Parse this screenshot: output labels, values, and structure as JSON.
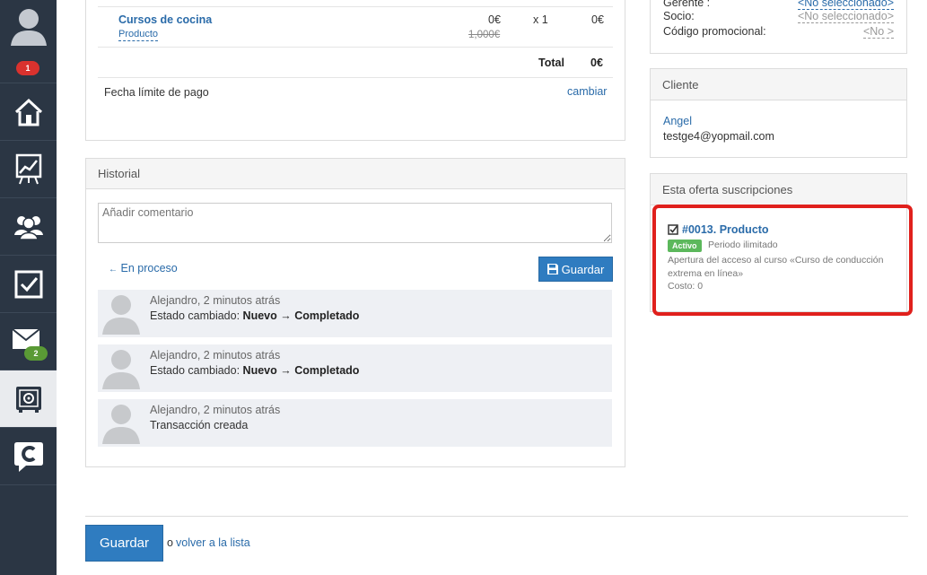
{
  "sidebar": {
    "notifications_badge": "1",
    "mail_badge": "2",
    "icons": [
      "user-avatar-icon",
      "home-icon",
      "chart-icon",
      "users-icon",
      "checkbox-icon",
      "mail-icon",
      "safe-icon",
      "chat-logo-icon"
    ]
  },
  "order": {
    "item_name": "Cursos de cocina",
    "item_type": "Producto",
    "price": "0€",
    "old_price": "1,000€",
    "qty": "x 1",
    "line_total": "0€",
    "total_label": "Total",
    "total_value": "0€",
    "due_label": "Fecha límite de pago",
    "due_action": "cambiar"
  },
  "history": {
    "title": "Historial",
    "comment_placeholder": "Añadir comentario",
    "status_link": "En proceso",
    "save_label": "Guardar",
    "items": [
      {
        "author": "Alejandro",
        "time": ", 2 minutos atrás",
        "prefix": "Estado cambiado: ",
        "from": "Nuevo",
        "arrow": " → ",
        "to": "Completado"
      },
      {
        "author": "Alejandro",
        "time": ", 2 minutos atrás",
        "prefix": "Estado cambiado: ",
        "from": "Nuevo",
        "arrow": " → ",
        "to": "Completado"
      },
      {
        "author": "Alejandro",
        "time": ", 2 minutos atrás",
        "prefix": "Transacción creada",
        "from": "",
        "arrow": "",
        "to": ""
      }
    ]
  },
  "details": {
    "manager_label": "Gerente :",
    "manager_value": "<No seleccionado>",
    "partner_label": "Socio:",
    "partner_value": "<No seleccionado>",
    "promo_label": "Código promocional:",
    "promo_value": "<No >"
  },
  "client": {
    "title": "Cliente",
    "name": "Angel",
    "email": "testge4@yopmail.com"
  },
  "subscriptions": {
    "title": "Esta oferta suscripciones",
    "item_title": "#0013. Producto",
    "status_badge": "Activo",
    "period": "Periodo ilimitado",
    "description": "Apertura del acceso al curso «Curso de conducción extrema en línea»",
    "cost": "Costo: 0",
    "highlight_color": "#e0201c"
  },
  "footer": {
    "save_label": "Guardar",
    "or_text": "o",
    "back_link": "volver a la lista"
  }
}
